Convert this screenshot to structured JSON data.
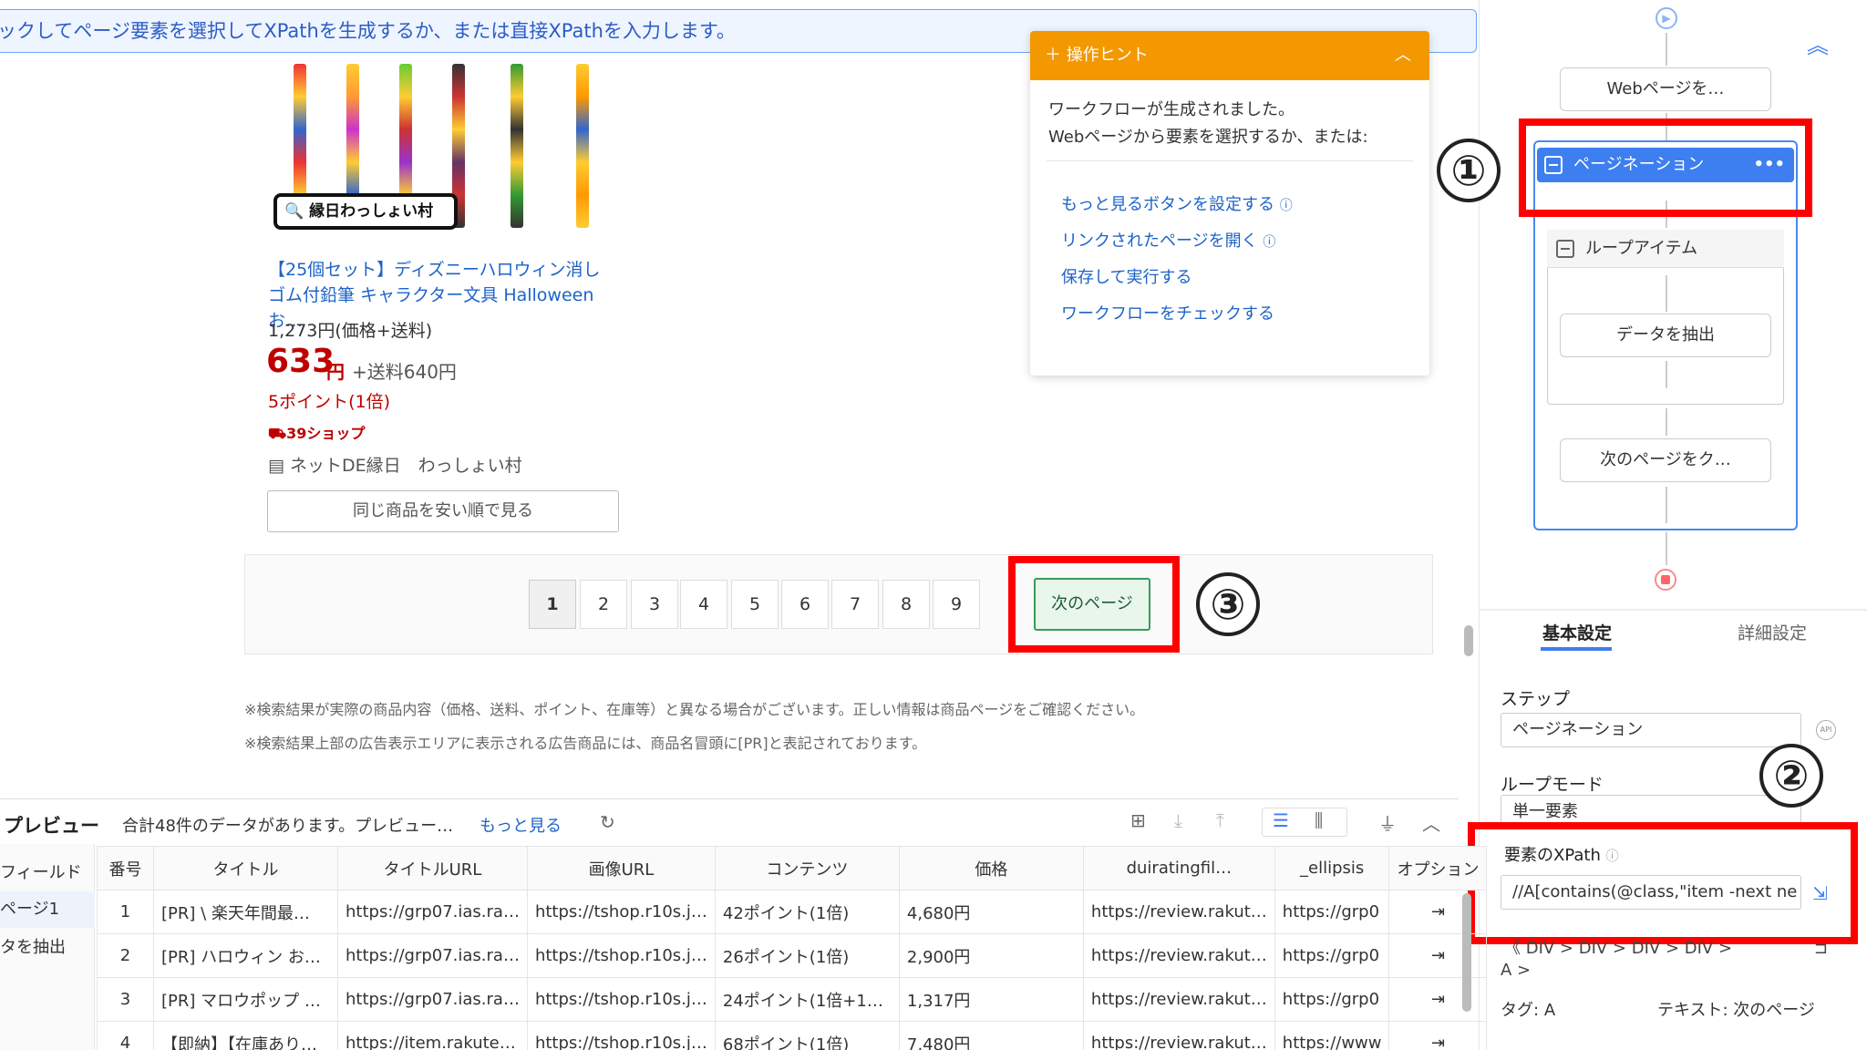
{
  "banner": {
    "text": "ックしてページ要素を選択してXPathを生成するか、または直接XPathを入力します。"
  },
  "product": {
    "stamp": "縁日わっしょい村",
    "title": "【25個セット】ディズニーハロウィン消しゴム付鉛筆 キャラクター文具 Halloween お…",
    "price_orig": "1,273円(価格+送料)",
    "price_main": "633",
    "price_yen": "円",
    "shipping": "+送料640円",
    "points": "5ポイント(1倍)",
    "shop39": "39ショップ",
    "shop_name": "ネットDE縁日　わっしょい村",
    "same_btn": "同じ商品を安い順で見る"
  },
  "pagination": {
    "pages": [
      "1",
      "2",
      "3",
      "4",
      "5",
      "6",
      "7",
      "8",
      "9"
    ],
    "next": "次のページ"
  },
  "notes": [
    "※検索結果が実際の商品内容（価格、送料、ポイント、在庫等）と異なる場合がございます。正しい情報は商品ページをご確認ください。",
    "※検索結果上部の広告表示エリアに表示される広告商品には、商品名冒頭に[PR]と表記されております。"
  ],
  "hint": {
    "title": "操作ヒント",
    "line1": "ワークフローが生成されました。",
    "line2": "Webページから要素を選択するか、または:",
    "links": [
      "もっと見るボタンを設定する",
      "リンクされたページを開く",
      "保存して実行する",
      "ワークフローをチェックする"
    ]
  },
  "callouts": {
    "one": "①",
    "two": "②",
    "three": "③"
  },
  "workflow": {
    "open_page": "Webページを…",
    "pagination": "ページネーション",
    "loop_item": "ループアイテム",
    "extract": "データを抽出",
    "next_click": "次のページをク…"
  },
  "settings": {
    "tab_basic": "基本設定",
    "tab_detail": "詳細設定",
    "step_label": "ステップ",
    "step_value": "ページネーション",
    "loop_label": "ループモード",
    "loop_value": "単一要素",
    "xpath_label": "要素のXPath",
    "xpath_value": "//A[contains(@class,\"item -next ne",
    "breadcrumb": "《 DIV  >  DIV  >  DIV  >  DIV  >",
    "breadcrumb2": "A  >",
    "tag_label": "タグ:",
    "tag_value": "A",
    "text_label": "テキスト:",
    "text_value": "次のページ"
  },
  "preview": {
    "title": "プレビュー",
    "summary": "合計48件のデータがあります。プレビュー…",
    "more": "もっと見る",
    "fields": [
      "フィールド",
      "ページ1",
      "タを抽出"
    ],
    "columns": [
      "番号",
      "タイトル",
      "タイトルURL",
      "画像URL",
      "コンテンツ",
      "価格",
      "duiratingfil…",
      "_ellipsis",
      "オプション"
    ],
    "rows": [
      [
        "1",
        "[PR] \\ 楽天年間最…",
        "https://grp07.ias.ra…",
        "https://tshop.r10s.j…",
        "42ポイント(1倍)",
        "4,680円",
        "https://review.rakut…",
        "https://grp0"
      ],
      [
        "2",
        "[PR] ハロウィン お…",
        "https://grp07.ias.ra…",
        "https://tshop.r10s.j…",
        "26ポイント(1倍)",
        "2,900円",
        "https://review.rakut…",
        "https://grp0"
      ],
      [
        "3",
        "[PR] マロウポップ …",
        "https://grp07.ias.ra…",
        "https://tshop.r10s.j…",
        "24ポイント(1倍+1…",
        "1,317円",
        "https://review.rakut…",
        "https://grp0"
      ],
      [
        "4",
        "【即納】【在庫あり…",
        "https://item.rakute…",
        "https://tshop.r10s.j…",
        "68ポイント(1倍)",
        "7,480円",
        "https://review.rakut…",
        "https://www"
      ]
    ]
  }
}
